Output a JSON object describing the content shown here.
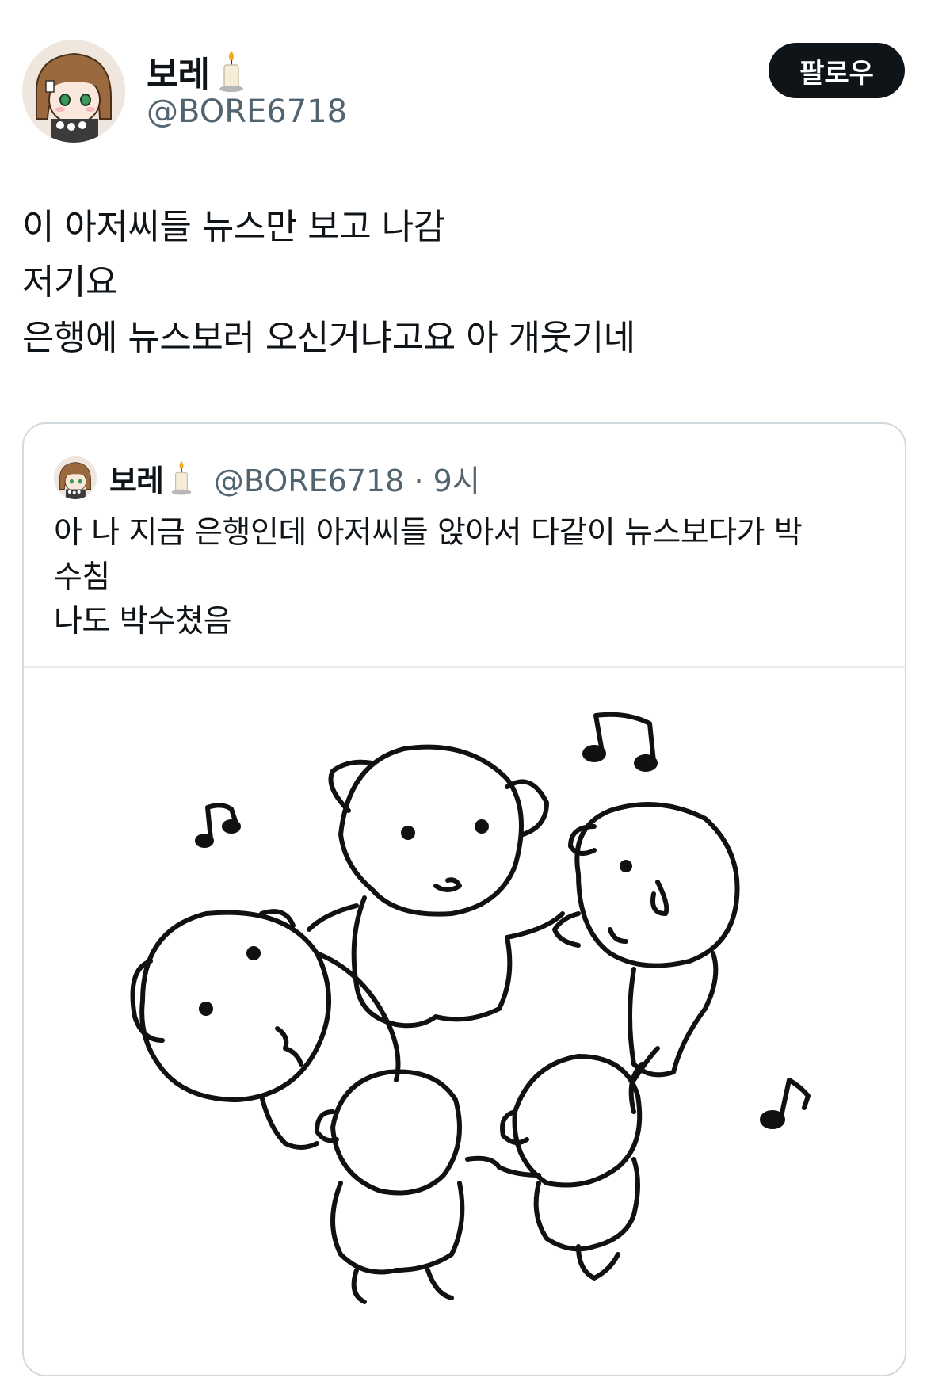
{
  "tweet": {
    "author": {
      "name": "보레",
      "handle": "@BORE6718",
      "name_emoji": "candle-icon"
    },
    "follow_label": "팔로우",
    "text_lines": [
      "이 아저씨들 뉴스만 보고 나감",
      "저기요",
      "은행에 뉴스보러 오신거냐고요 아 개웃기네"
    ]
  },
  "quoted_tweet": {
    "author": {
      "name": "보레",
      "handle": "@BORE6718",
      "name_emoji": "candle-icon"
    },
    "time": "9시",
    "separator": "·",
    "text_lines": [
      "아 나 지금 은행인데 아저씨들 앉아서 다같이 뉴스보다가 박",
      "수침",
      "나도 박수쳤음"
    ],
    "image": {
      "description_icon": "dancing-dogs-illustration"
    }
  },
  "colors": {
    "text": "#0f1419",
    "secondary": "#536471",
    "border": "#cfd9de",
    "button_bg": "#0f1419",
    "button_text": "#ffffff"
  }
}
